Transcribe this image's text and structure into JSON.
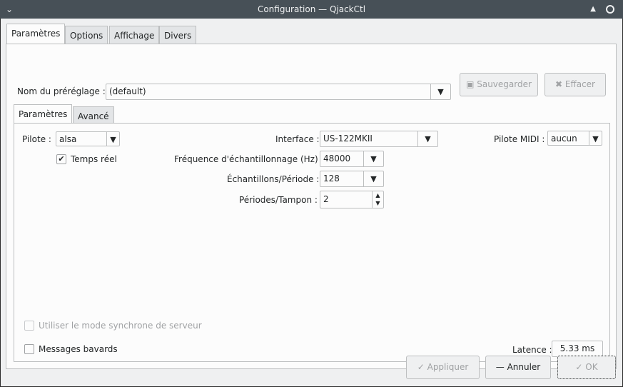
{
  "window": {
    "title": "Configuration — QjackCtl"
  },
  "tabs": [
    "Paramètres",
    "Options",
    "Affichage",
    "Divers"
  ],
  "preset": {
    "label": "Nom du préréglage :",
    "value": "(default)",
    "save": "Sauvegarder",
    "delete": "Effacer"
  },
  "subtabs": [
    "Paramètres",
    "Avancé"
  ],
  "settings": {
    "driver_label": "Pilote :",
    "driver": "alsa",
    "realtime_label": "Temps réel",
    "realtime": true,
    "interface_label": "Interface :",
    "interface": "US-122MKII",
    "midi_label": "Pilote MIDI :",
    "midi": "aucun",
    "rate_label": "Fréquence d'échantillonnage (Hz) :",
    "rate": "48000",
    "frames_label": "Échantillons/Période :",
    "frames": "128",
    "periods_label": "Périodes/Tampon :",
    "periods": "2",
    "sync_label": "Utiliser le mode synchrone de serveur",
    "sync": false,
    "verbose_label": "Messages bavards",
    "verbose": false,
    "latency_label": "Latence :",
    "latency": "5.33 ms"
  },
  "buttons": {
    "apply": "Appliquer",
    "cancel": "Annuler",
    "ok": "OK"
  }
}
